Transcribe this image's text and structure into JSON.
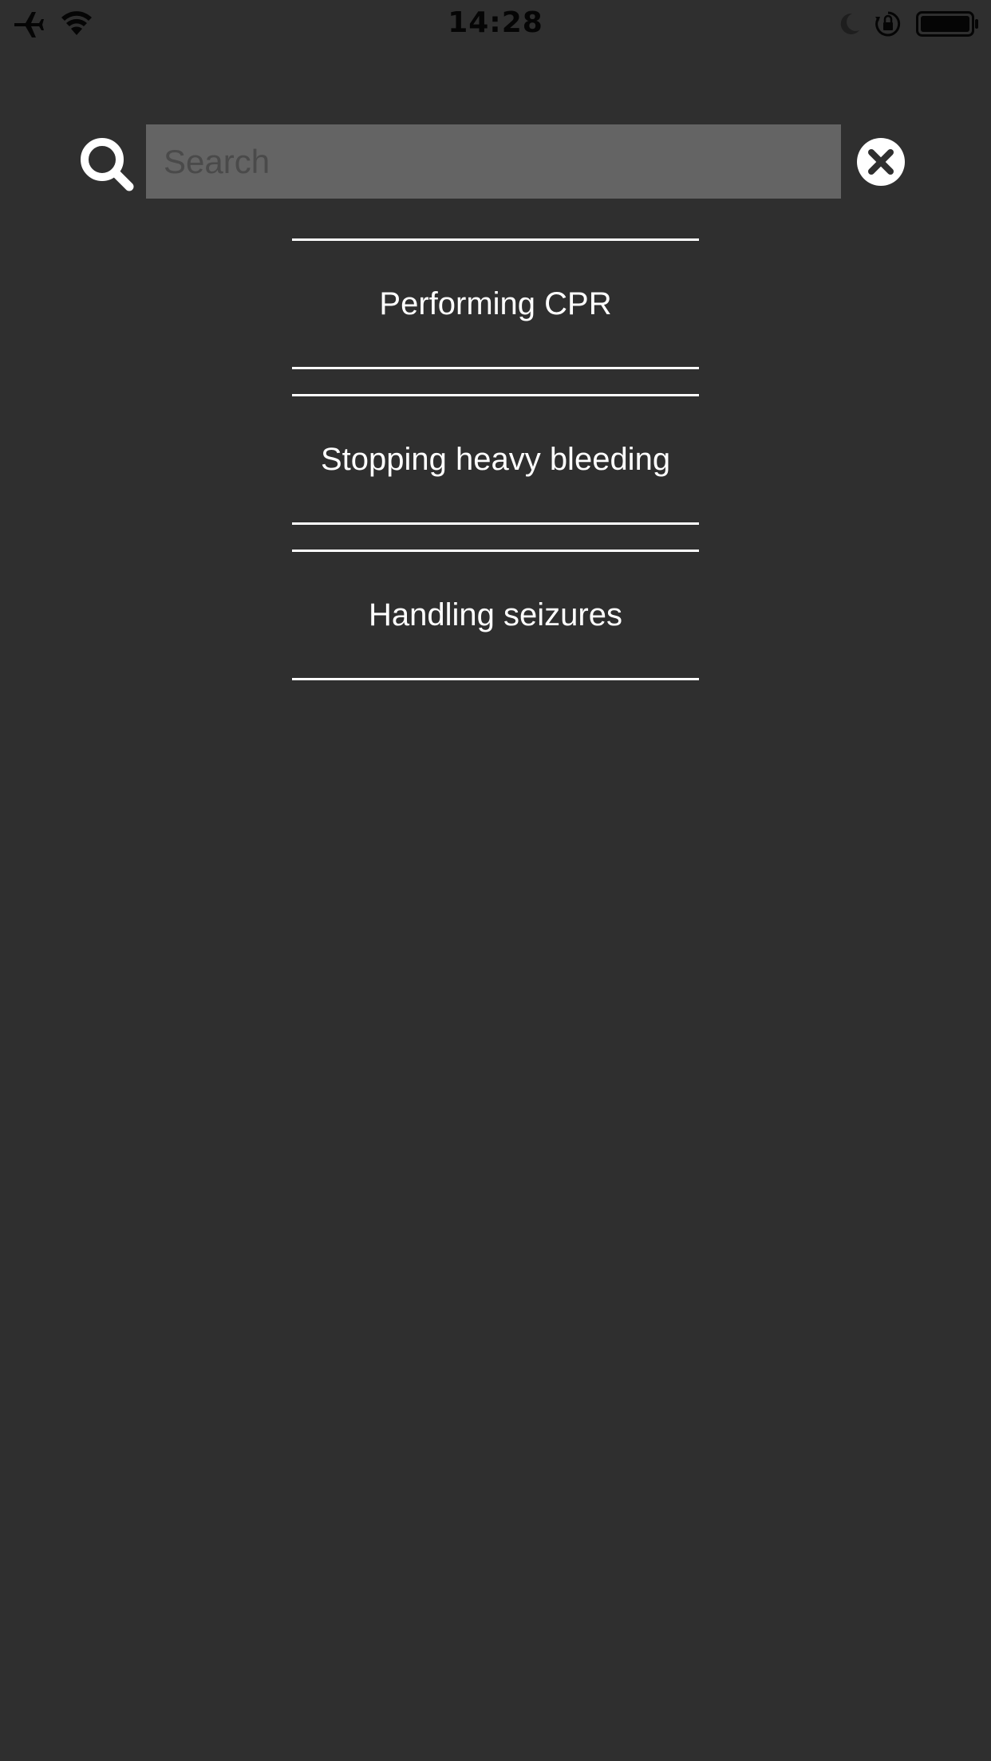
{
  "status_bar": {
    "time": "14:28",
    "left_icons": [
      "airplane-mode-icon",
      "wifi-icon"
    ],
    "right_icons": [
      "do-not-disturb-icon",
      "orientation-lock-icon",
      "battery-icon"
    ]
  },
  "search": {
    "placeholder": "Search",
    "value": "",
    "search_icon": "search-icon",
    "clear_icon": "close-circle-icon"
  },
  "results": [
    {
      "label": "Performing CPR"
    },
    {
      "label": "Stopping heavy bleeding"
    },
    {
      "label": "Handling seizures"
    }
  ],
  "colors": {
    "background": "#2f2f2f",
    "search_field": "#646464",
    "text": "#ffffff",
    "status_bar_text": "#050505"
  }
}
